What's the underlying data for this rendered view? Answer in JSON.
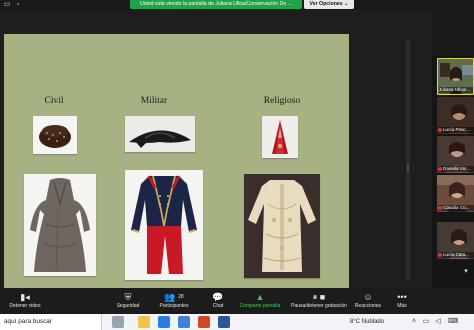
{
  "zoom": {
    "share_banner": "Usted está viendo la pantalla de Juliana Ulloa/Conservación De ...",
    "view_options": "Ver Opciones",
    "view_options_caret": "⌄"
  },
  "slide": {
    "categories": [
      "Civil",
      "Militar",
      "Religioso"
    ]
  },
  "participants": [
    {
      "name": "Juliana Ulloa/..."
    },
    {
      "name": "Lucía Pesc..."
    },
    {
      "name": "Daniela Vin..."
    },
    {
      "name": "Claudia Co..."
    },
    {
      "name": "Lucía Cara..."
    }
  ],
  "toolbar": {
    "stop_video": "Detener video",
    "security": "Seguridad",
    "participants": "Participantes",
    "participants_count": "28",
    "chat": "Chat",
    "share_screen": "Comparte pantalla",
    "pause_recording": "Pausa/detener grabación",
    "reactions": "Reacciones",
    "more": "Más"
  },
  "taskbar": {
    "search_placeholder": "aquí para buscar",
    "temperature": "8°C",
    "weather": "Nublado"
  },
  "icons": {
    "minimize": "minimize-icon",
    "shield": "shield-icon",
    "people": "people-icon",
    "chat": "chat-bubble-icon",
    "share": "share-screen-icon",
    "record": "record-pause-icon",
    "reaction": "emoji-icon",
    "more": "more-icon",
    "video": "video-camera-icon"
  },
  "colors": {
    "share_green": "#22a34a",
    "slide_bg": "#a6b282",
    "toolbar_bg": "#1c1c1c"
  }
}
